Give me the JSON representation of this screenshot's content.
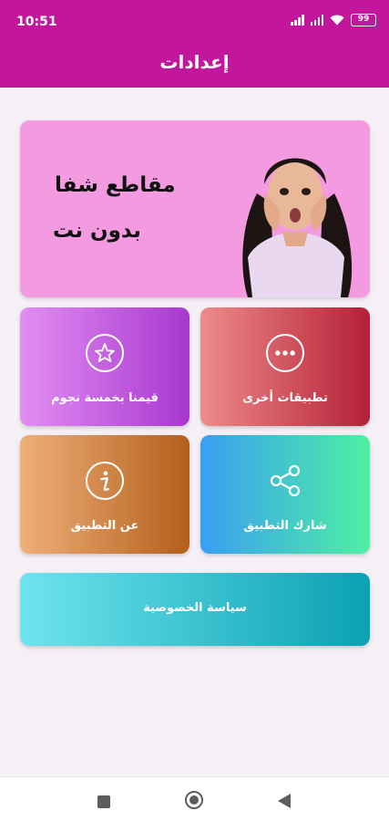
{
  "status_bar": {
    "time": "10:51",
    "battery": "99"
  },
  "header": {
    "title": "إعدادات"
  },
  "banner": {
    "line1": "مقاطع شفا",
    "line2": "بدون نت"
  },
  "tiles": {
    "rate": {
      "label": "قيمنا بخمسة نجوم",
      "icon": "star-icon"
    },
    "other_apps": {
      "label": "تطبيقات أخرى",
      "icon": "more-dots-icon"
    },
    "about": {
      "label": "عن التطبيق",
      "icon": "info-icon"
    },
    "share": {
      "label": "شارك التطبيق",
      "icon": "share-icon"
    }
  },
  "privacy": {
    "label": "سياسة الخصوصية"
  },
  "colors": {
    "header": "#c2169d",
    "banner": "#f49ae0",
    "rate": [
      "#e28ef2",
      "#a737cf"
    ],
    "other_apps": [
      "#ee8b8a",
      "#b42037"
    ],
    "about": [
      "#efaf79",
      "#b35f1c"
    ],
    "share": [
      "#3a9ef2",
      "#4df0a2"
    ],
    "privacy": [
      "#6ee4ef",
      "#0aa1b2"
    ]
  }
}
